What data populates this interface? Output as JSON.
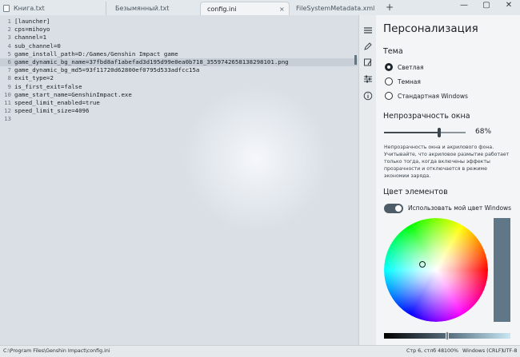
{
  "tabs": [
    {
      "label": "Книга.txt",
      "active": false
    },
    {
      "label": "Безымянный.txt",
      "active": false
    },
    {
      "label": "config.ini",
      "active": true
    },
    {
      "label": "FileSystemMetadata.xml",
      "active": false
    }
  ],
  "icons": {
    "file": "document-icon",
    "close": "close-icon",
    "new_tab": "plus-icon",
    "minimize": "minimize-icon",
    "maximize": "maximize-icon",
    "window_close": "window-close-icon",
    "strip": [
      "menu-icon",
      "pen-icon",
      "paint-icon",
      "sliders-icon",
      "info-icon"
    ]
  },
  "glyphs": {
    "close": "×",
    "new_tab": "+",
    "minimize": "—",
    "maximize": "▢",
    "window_close": "✕"
  },
  "editor": {
    "lines": [
      {
        "n": "1",
        "text": "[launcher]"
      },
      {
        "n": "2",
        "text": "cps=mihoyo"
      },
      {
        "n": "3",
        "text": "channel=1"
      },
      {
        "n": "4",
        "text": "sub_channel=0"
      },
      {
        "n": "5",
        "text": "game_install_path=D:/Games/Genshin Impact game"
      },
      {
        "n": "6",
        "text": "game_dynamic_bg_name=37fbd8af1abefad3d195d99e0ea0b718_3559742658138298101.png"
      },
      {
        "n": "7",
        "text": "game_dynamic_bg_md5=93f11720d62800ef0795d533adfcc15a"
      },
      {
        "n": "8",
        "text": "exit_type=2"
      },
      {
        "n": "9",
        "text": "is_first_exit=false"
      },
      {
        "n": "10",
        "text": "game_start_name=GenshinImpact.exe"
      },
      {
        "n": "11",
        "text": "speed_limit_enabled=true"
      },
      {
        "n": "12",
        "text": "speed_limit_size=4096"
      },
      {
        "n": "13",
        "text": ""
      }
    ],
    "current_line": 6
  },
  "panel": {
    "title": "Персонализация",
    "theme_heading": "Тема",
    "themes": [
      {
        "label": "Светлая",
        "selected": true
      },
      {
        "label": "Темная",
        "selected": false
      },
      {
        "label": "Стандартная Windows",
        "selected": false
      }
    ],
    "opacity_heading": "Непрозрачность окна",
    "opacity_value": 68,
    "opacity_label": "68%",
    "opacity_description": "Непрозрачность окна и акрилового фона. Учитывайте, что акриловое размытие работает только тогда, когда включены эффекты прозрачности и отключается в режиме экономии заряда.",
    "color_heading": "Цвет элементов",
    "use_windows_color_label": "Использовать мой цвет Windows",
    "use_windows_color_on": true,
    "accent_color": "#5f7787",
    "brightness_value": 50
  },
  "status": {
    "path": "C:\\Program Files\\Genshin Impact\\config.ini",
    "position": "Стр 6, стлб 48",
    "zoom": "100%",
    "line_endings": "Windows (CRLF)",
    "encoding": "UTF-8"
  }
}
